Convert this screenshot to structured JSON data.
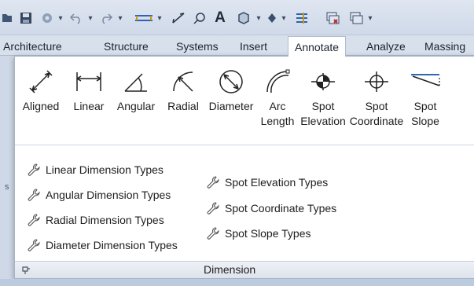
{
  "qat": {
    "items": [
      {
        "name": "open-icon",
        "glyph": "⊳"
      },
      {
        "name": "save-icon",
        "glyph": "🖫"
      },
      {
        "name": "sync-icon",
        "glyph": "⚙"
      },
      {
        "name": "undo-icon",
        "glyph": "↶"
      },
      {
        "name": "redo-icon",
        "glyph": "↷"
      },
      {
        "name": "measure-icon",
        "glyph": "⟷"
      },
      {
        "name": "aligned-dimension-icon",
        "glyph": "⤢"
      },
      {
        "name": "tag-icon",
        "glyph": "⌖"
      },
      {
        "name": "text-icon",
        "glyph": "A"
      },
      {
        "name": "3d-view-icon",
        "glyph": "⬡"
      },
      {
        "name": "section-icon",
        "glyph": "◆"
      },
      {
        "name": "thin-lines-icon",
        "glyph": "☰"
      },
      {
        "name": "close-hidden-icon",
        "glyph": "⧉"
      },
      {
        "name": "switch-windows-icon",
        "glyph": "⧉"
      }
    ]
  },
  "tabs": [
    {
      "label": "Architecture",
      "active": false
    },
    {
      "label": "Structure",
      "active": false
    },
    {
      "label": "Systems",
      "active": false
    },
    {
      "label": "Insert",
      "active": false
    },
    {
      "label": "Annotate",
      "active": true
    },
    {
      "label": "Analyze",
      "active": false
    },
    {
      "label": "Massing",
      "active": false
    }
  ],
  "tools": [
    {
      "label_lines": [
        "Aligned"
      ]
    },
    {
      "label_lines": [
        "Linear"
      ]
    },
    {
      "label_lines": [
        "Angular"
      ]
    },
    {
      "label_lines": [
        "Radial"
      ]
    },
    {
      "label_lines": [
        "Diameter"
      ]
    },
    {
      "label_lines": [
        "Arc",
        "Length"
      ]
    },
    {
      "label_lines": [
        "Spot",
        "Elevation"
      ]
    },
    {
      "label_lines": [
        "Spot",
        "Coordinate"
      ]
    },
    {
      "label_lines": [
        "Spot",
        "Slope"
      ]
    }
  ],
  "menu": {
    "left": [
      "Linear Dimension Types",
      "Angular Dimension Types",
      "Radial Dimension Types",
      "Diameter Dimension Types"
    ],
    "right": [
      "Spot Elevation Types",
      "Spot Coordinate Types",
      "Spot Slope Types"
    ]
  },
  "panel": {
    "title": "Dimension"
  },
  "colors": {
    "accent": "#2f6fb5",
    "ribbon_bg": "#d8e0ec",
    "panel_bg": "#ffffff"
  }
}
